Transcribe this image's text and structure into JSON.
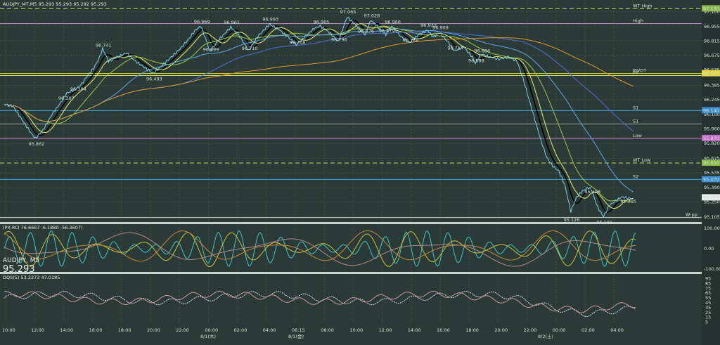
{
  "chart_data": {
    "type": "line",
    "symbol": "AUDJPY",
    "timeframe": "M5",
    "header": "AUDJPY_MT,M5  95.293 95.293 95.292 95.293",
    "big_symbol": "AUDJPY, M5",
    "big_price": "95.293",
    "x_ticks": [
      "10:00",
      "12:00",
      "14:00",
      "16:00",
      "18:00",
      "20:00",
      "22:00",
      "00:00",
      "02:00",
      "04:00",
      "06:15",
      "08:00",
      "10:00",
      "12:00",
      "14:00",
      "16:00",
      "18:00",
      "20:00",
      "22:00",
      "00:00",
      "02:00",
      "04:00"
    ],
    "date_labels": [
      "8/1(木)",
      "8/1(金)",
      "8/2(土)"
    ],
    "y_ticks": [
      "97.100",
      "96.955",
      "96.815",
      "96.675",
      "96.535",
      "96.385",
      "96.245",
      "96.100",
      "95.960",
      "95.820",
      "95.675",
      "95.535",
      "95.390",
      "95.250",
      "95.105"
    ],
    "ylim": [
      95.07,
      97.16
    ],
    "price_labels": [
      {
        "t": 10.5,
        "p": 95.862,
        "text": "95.862"
      },
      {
        "t": 20.5,
        "p": 96.307,
        "text": "96.307"
      },
      {
        "t": 24.5,
        "p": 96.394,
        "text": "96.394"
      },
      {
        "t": 33,
        "p": 96.741,
        "text": "96.741"
      },
      {
        "t": 50,
        "p": 96.493,
        "text": "96.493"
      },
      {
        "t": 66,
        "p": 96.969,
        "text": "96.969"
      },
      {
        "t": 69,
        "p": 96.699,
        "text": "96.699"
      },
      {
        "t": 76,
        "p": 96.961,
        "text": "96.961"
      },
      {
        "t": 82,
        "p": 96.71,
        "text": "96.710"
      },
      {
        "t": 89,
        "p": 96.993,
        "text": "96.993"
      },
      {
        "t": 98,
        "p": 96.768,
        "text": "96.768"
      },
      {
        "t": 106,
        "p": 96.965,
        "text": "96.965"
      },
      {
        "t": 112,
        "p": 96.796,
        "text": "96.796"
      },
      {
        "t": 115,
        "p": 97.065,
        "text": "97.065"
      },
      {
        "t": 123,
        "p": 97.028,
        "text": "97.028"
      },
      {
        "t": 121,
        "p": 96.876,
        "text": "96.876"
      },
      {
        "t": 128,
        "p": 96.879,
        "text": "96.879"
      },
      {
        "t": 130,
        "p": 96.966,
        "text": "96.966"
      },
      {
        "t": 142,
        "p": 96.933,
        "text": "96.933"
      },
      {
        "t": 136,
        "p": 96.788,
        "text": "96.788"
      },
      {
        "t": 146,
        "p": 96.909,
        "text": "96.909"
      },
      {
        "t": 151,
        "p": 96.714,
        "text": "96.714"
      },
      {
        "t": 160,
        "p": 96.686,
        "text": "96.686"
      },
      {
        "t": 158,
        "p": 96.588,
        "text": "96.588"
      },
      {
        "t": 197,
        "p": 95.398,
        "text": "95.398"
      },
      {
        "t": 190,
        "p": 95.126,
        "text": "95.126"
      },
      {
        "t": 209,
        "p": 95.305,
        "text": "95.305"
      },
      {
        "t": 201,
        "p": 95.101,
        "text": "95.101"
      }
    ],
    "levels": [
      {
        "name": "WT High",
        "p": 97.13,
        "color": "#b8e05a",
        "dash": true
      },
      {
        "name": "High",
        "p": 96.985,
        "color": "#d58ad8",
        "dash": false
      },
      {
        "name": "PIVOT",
        "p": 96.5,
        "color": "#f1e04a",
        "dash": false
      },
      {
        "name": "PP",
        "p": 96.48,
        "color": "#d6e24d",
        "dash": false
      },
      {
        "name": "S1",
        "p": 96.14,
        "color": "#3fa3df",
        "dash": false
      },
      {
        "name": "S1",
        "p": 96.01,
        "color": "#9aa7a3",
        "dash": false
      },
      {
        "name": "Low",
        "p": 95.87,
        "color": "#d58ad8",
        "dash": false
      },
      {
        "name": "WT Low",
        "p": 95.63,
        "color": "#b8e05a",
        "dash": true
      },
      {
        "name": "S2",
        "p": 95.47,
        "color": "#3fa3df",
        "dash": false
      },
      {
        "name": "W-pp",
        "p": 95.1,
        "color": "#c8d2ce",
        "dash": false
      }
    ],
    "badges": [
      {
        "text": "97.130",
        "p": 97.13,
        "color": "#8ab84b"
      },
      {
        "text": "96.500",
        "p": 96.5,
        "color": "#e6d23f"
      },
      {
        "text": "96.140",
        "p": 96.14,
        "color": "#3f8fd0"
      },
      {
        "text": "95.870",
        "p": 95.87,
        "color": "#c86cc8"
      },
      {
        "text": "95.630",
        "p": 95.63,
        "color": "#8ab84b"
      },
      {
        "text": "95.470",
        "p": 95.47,
        "color": "#3f8fd0"
      },
      {
        "text": "95.293",
        "p": 95.293,
        "color": "#e8ecea"
      }
    ],
    "close_series": [
      [
        0,
        96.2
      ],
      [
        3,
        96.18
      ],
      [
        6,
        96.05
      ],
      [
        9,
        95.92
      ],
      [
        10.5,
        95.87
      ],
      [
        13,
        95.95
      ],
      [
        16,
        96.1
      ],
      [
        19,
        96.22
      ],
      [
        21,
        96.31
      ],
      [
        24,
        96.35
      ],
      [
        26,
        96.4
      ],
      [
        28,
        96.48
      ],
      [
        30,
        96.55
      ],
      [
        32,
        96.66
      ],
      [
        33,
        96.74
      ],
      [
        35,
        96.62
      ],
      [
        38,
        96.66
      ],
      [
        41,
        96.7
      ],
      [
        44,
        96.62
      ],
      [
        47,
        96.56
      ],
      [
        50,
        96.5
      ],
      [
        53,
        96.58
      ],
      [
        56,
        96.66
      ],
      [
        59,
        96.74
      ],
      [
        62,
        96.84
      ],
      [
        64,
        96.92
      ],
      [
        66,
        96.96
      ],
      [
        68,
        96.8
      ],
      [
        69,
        96.71
      ],
      [
        72,
        96.83
      ],
      [
        76,
        96.95
      ],
      [
        79,
        96.86
      ],
      [
        82,
        96.72
      ],
      [
        85,
        96.86
      ],
      [
        89,
        96.98
      ],
      [
        92,
        96.93
      ],
      [
        95,
        96.86
      ],
      [
        98,
        96.78
      ],
      [
        101,
        96.86
      ],
      [
        104,
        96.94
      ],
      [
        106,
        96.96
      ],
      [
        109,
        96.9
      ],
      [
        112,
        96.81
      ],
      [
        115,
        97.05
      ],
      [
        118,
        96.97
      ],
      [
        121,
        96.88
      ],
      [
        123,
        97.02
      ],
      [
        126,
        96.93
      ],
      [
        128,
        96.88
      ],
      [
        130,
        96.96
      ],
      [
        133,
        96.86
      ],
      [
        136,
        96.8
      ],
      [
        139,
        96.88
      ],
      [
        142,
        96.92
      ],
      [
        144,
        96.85
      ],
      [
        146,
        96.9
      ],
      [
        149,
        96.8
      ],
      [
        151,
        96.72
      ],
      [
        154,
        96.76
      ],
      [
        157,
        96.66
      ],
      [
        158,
        96.6
      ],
      [
        160,
        96.69
      ],
      [
        163,
        96.66
      ],
      [
        166,
        96.64
      ],
      [
        169,
        96.66
      ],
      [
        172,
        96.62
      ],
      [
        174,
        96.45
      ],
      [
        176,
        96.25
      ],
      [
        178,
        96.05
      ],
      [
        180,
        95.85
      ],
      [
        182,
        95.68
      ],
      [
        184,
        95.6
      ],
      [
        186,
        95.55
      ],
      [
        188,
        95.42
      ],
      [
        190,
        95.16
      ],
      [
        192,
        95.3
      ],
      [
        194,
        95.36
      ],
      [
        196,
        95.39
      ],
      [
        197,
        95.37
      ],
      [
        199,
        95.2
      ],
      [
        201,
        95.11
      ],
      [
        203,
        95.22
      ],
      [
        205,
        95.26
      ],
      [
        207,
        95.3
      ],
      [
        209,
        95.29
      ],
      [
        211,
        95.29
      ]
    ],
    "ma_series": [
      {
        "name": "ma1",
        "color": "#000000",
        "width": 1.6,
        "lag": 3
      },
      {
        "name": "ma2",
        "color": "#e8f26a",
        "width": 1.0,
        "lag": 6
      },
      {
        "name": "ma3",
        "color": "#9cc84a",
        "width": 1.0,
        "lag": 14
      },
      {
        "name": "ma4",
        "color": "#5fa8e8",
        "width": 1.0,
        "lag": 30
      },
      {
        "name": "ma5",
        "color": "#4f6fd8",
        "width": 1.0,
        "lag": 60
      },
      {
        "name": "ma6",
        "color": "#e09a2a",
        "width": 1.0,
        "lag": 110
      }
    ],
    "osc1": {
      "header": "(PX-RCI 76.6667 -6.1880 -56.3607)",
      "right_ticks": [
        "100.0000",
        "0.00",
        "-100.0000"
      ],
      "ylim": [
        -110,
        110
      ]
    },
    "osc2": {
      "header": "DQS(5) 53.2273 47.0185",
      "right_ticks": [
        "95",
        "85",
        "75",
        "65",
        "55",
        "45",
        "35",
        "25",
        "15",
        "5"
      ],
      "ylim": [
        0,
        100
      ]
    }
  }
}
